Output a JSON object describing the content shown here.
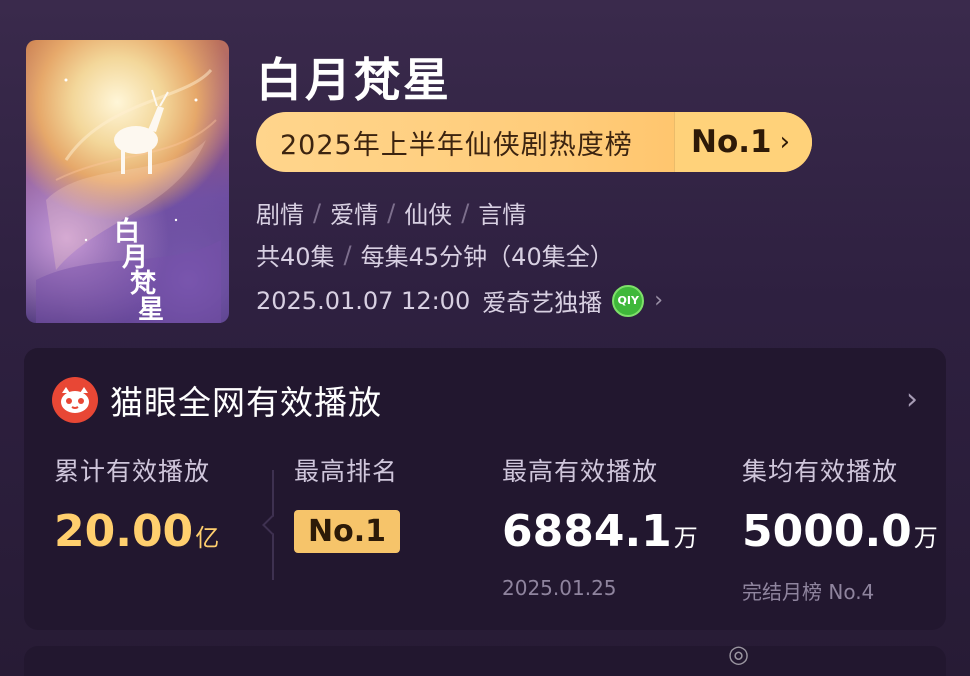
{
  "show": {
    "title": "白月梵星",
    "rank_text": "2025年上半年仙侠剧热度榜",
    "rank_badge": "No.1",
    "genres": [
      "剧情",
      "爱情",
      "仙侠",
      "言情"
    ],
    "episodes": {
      "count": "共40集",
      "duration": "每集45分钟（40集全）"
    },
    "release": {
      "datetime": "2025.01.07 12:00",
      "platform": "爱奇艺独播",
      "platform_icon_text": "QIY"
    },
    "poster_calligraphy": "白月梵星"
  },
  "maoyan": {
    "title": "猫眼全网有效播放",
    "stats": [
      {
        "label": "累计有效播放",
        "value": "20.00",
        "unit": "亿"
      },
      {
        "label": "最高排名",
        "badge": "No.1"
      },
      {
        "label": "最高有效播放",
        "value": "6884.1",
        "unit": "万",
        "sub": "2025.01.25"
      },
      {
        "label": "集均有效播放",
        "value": "5000.0",
        "unit": "万",
        "sub": "完结月榜 No.4"
      }
    ]
  },
  "watermark": "◎"
}
